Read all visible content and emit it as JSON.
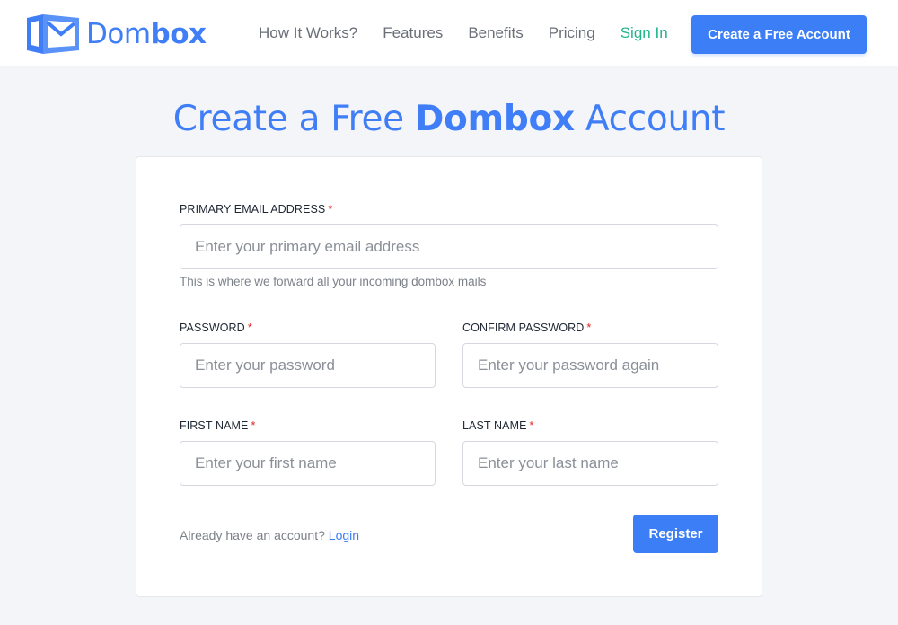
{
  "nav": {
    "logo": {
      "light": "Dom",
      "bold": "box"
    },
    "links": [
      "How It Works?",
      "Features",
      "Benefits",
      "Pricing"
    ],
    "signin": "Sign In",
    "cta": "Create a Free Account"
  },
  "title": {
    "pre": "Create a Free ",
    "bold": "Dombox",
    "post": " Account"
  },
  "form": {
    "email": {
      "label": "PRIMARY EMAIL ADDRESS",
      "required": "*",
      "placeholder": "Enter your primary email address",
      "help": "This is where we forward all your incoming dombox mails"
    },
    "password": {
      "label": "PASSWORD",
      "required": "*",
      "placeholder": "Enter your password"
    },
    "confirm_password": {
      "label": "CONFIRM PASSWORD",
      "required": "*",
      "placeholder": "Enter your password again"
    },
    "first_name": {
      "label": "FIRST NAME",
      "required": "*",
      "placeholder": "Enter your first name"
    },
    "last_name": {
      "label": "LAST NAME",
      "required": "*",
      "placeholder": "Enter your last name"
    },
    "footer_text": "Already have an account?",
    "login_link": "Login",
    "register": "Register"
  },
  "colors": {
    "brand_blue": "#3b7ef6",
    "signin_green": "#1db488",
    "required_red": "#e02424"
  }
}
